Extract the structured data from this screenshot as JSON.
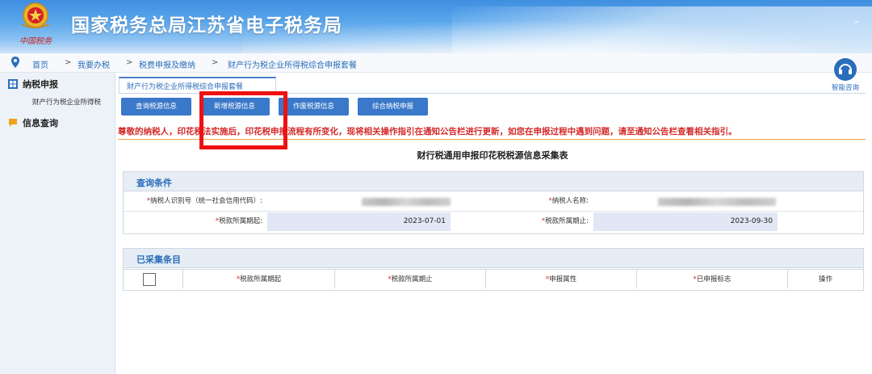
{
  "header": {
    "site_title": "国家税务总局江苏省电子税务局",
    "emblem_caption": "中国税务"
  },
  "breadcrumb": [
    "首页",
    "我要办税",
    "税费申报及缴纳",
    "财产行为税企业所得税综合申报套餐"
  ],
  "breadcrumb_separator": ">",
  "sidebar": {
    "groups": [
      {
        "label": "纳税申报",
        "icon": "grid-icon",
        "items": [
          "财产行为税企业所得税"
        ]
      },
      {
        "label": "信息查询",
        "icon": "chat-bubble-icon",
        "items": []
      }
    ]
  },
  "help": {
    "label": "智能咨询"
  },
  "tab": {
    "label": "财产行为税企业所得税综合申报套餐"
  },
  "buttons": {
    "query": "查询税源信息",
    "add": "新增税源信息",
    "void": "作废税源信息",
    "declare": "综合纳税申报"
  },
  "notice": "尊敬的纳税人，印花税法实施后，印花税申报流程有所变化，现将相关操作指引在通知公告栏进行更新，如您在申报过程中遇到问题，请至通知公告栏查看相关指引。",
  "form_title": "财行税通用申报印花税税源信息采集表",
  "query_panel": {
    "title": "查询条件",
    "taxpayer_id_label": "纳税人识别号（统一社会信用代码）:",
    "taxpayer_name_label": "纳税人名称:",
    "period_start_label": "税款所属期起:",
    "period_start_value": "2023-07-01",
    "period_end_label": "税款所属期止:",
    "period_end_value": "2023-09-30"
  },
  "collected_panel": {
    "title": "已采集条目",
    "columns": [
      "税款所属期起",
      "税款所属期止",
      "申报属性",
      "已申报标志",
      "操作"
    ]
  },
  "colors": {
    "accent": "#3a78c9",
    "highlight": "#e11111",
    "notice": "#d42a2a"
  }
}
